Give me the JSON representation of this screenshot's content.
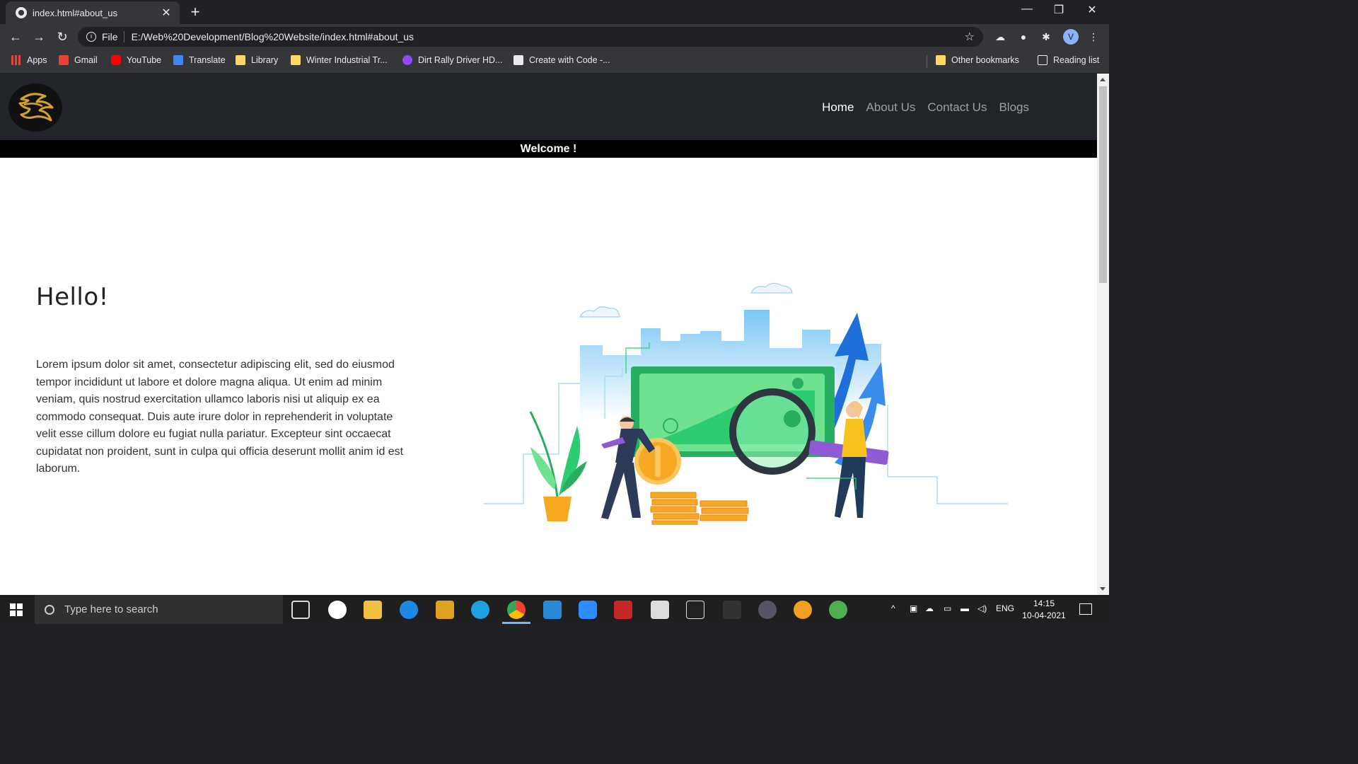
{
  "browser": {
    "tab_title": "index.html#about_us",
    "new_tab_label": "+",
    "url_scheme": "File",
    "url": "E:/Web%20Development/Blog%20Website/index.html#about_us",
    "profile_initial": "V",
    "bookmarks": [
      {
        "label": "Apps",
        "icon": "apps-icon"
      },
      {
        "label": "Gmail",
        "icon": "gmail-icon"
      },
      {
        "label": "YouTube",
        "icon": "youtube-icon"
      },
      {
        "label": "Translate",
        "icon": "translate-icon"
      },
      {
        "label": "Library",
        "icon": "folder-icon"
      },
      {
        "label": "Winter Industrial Tr...",
        "icon": "folder-icon"
      },
      {
        "label": "Dirt Rally Driver HD...",
        "icon": "twitch-icon"
      },
      {
        "label": "Create with Code -...",
        "icon": "unity-icon"
      }
    ],
    "other_bookmarks": "Other bookmarks",
    "reading_list": "Reading list"
  },
  "site": {
    "nav": [
      {
        "label": "Home",
        "active": true
      },
      {
        "label": "About Us",
        "active": false
      },
      {
        "label": "Contact Us",
        "active": false
      },
      {
        "label": "Blogs",
        "active": false
      }
    ],
    "welcome": "Welcome !",
    "heading": "Hello!",
    "body": "Lorem ipsum dolor sit amet, consectetur adipiscing elit, sed do eiusmod tempor incididunt ut labore et dolore magna aliqua. Ut enim ad minim veniam, quis nostrud exercitation ullamco laboris nisi ut aliquip ex ea commodo consequat. Duis aute irure dolor in reprehenderit in voluptate velit esse cillum dolore eu fugiat nulla pariatur. Excepteur sint occaecat cupidatat non proident, sunt in culpa qui officia deserunt mollit anim id est laborum.",
    "colors": {
      "navbar": "#212529",
      "welcome_bar": "#000000",
      "logo_gold": "#d4a326",
      "money_green": "#2ecc71",
      "coin_orange": "#f7a823",
      "arrow_blue": "#1e6fd9"
    }
  },
  "taskbar": {
    "search_placeholder": "Type here to search",
    "language": "ENG",
    "time": "14:15",
    "date": "10-04-2021"
  }
}
